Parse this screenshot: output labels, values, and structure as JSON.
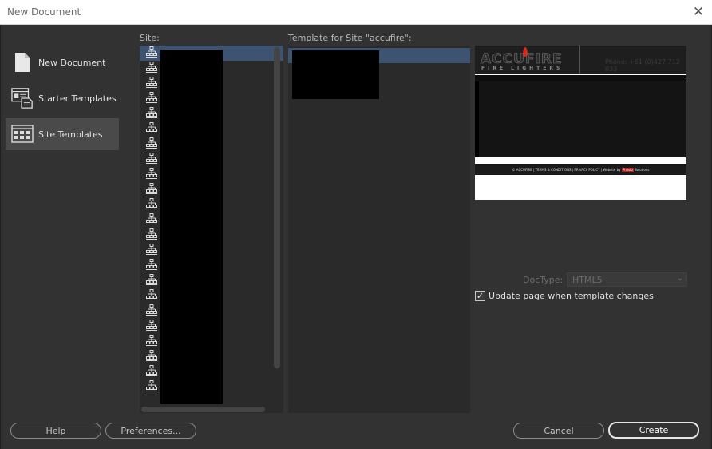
{
  "window": {
    "title": "New Document",
    "close_glyph": "✕"
  },
  "nav": {
    "items": [
      {
        "label": "New Document",
        "icon": "document-icon"
      },
      {
        "label": "Starter Templates",
        "icon": "starter-templates-icon"
      },
      {
        "label": "Site Templates",
        "icon": "site-templates-icon",
        "active": true
      }
    ]
  },
  "site_panel": {
    "label": "Site:",
    "row_icon": "site-tree-icon",
    "row_count": 23
  },
  "template_panel": {
    "label": "Template for Site \"accufire\":"
  },
  "preview": {
    "logo_text": "ACCUFIRE",
    "logo_subtext": "FIRE LIGHTERS",
    "phone_text": "Phone: +61 (0)427 712 033",
    "footer_text": "© ACCUFIRE | TERMS & CONDITIONS | PRIVACY POLICY | Website by",
    "footer_badge": "Physio",
    "footer_tail": "Solutions",
    "colors": {
      "header": "#1e1e1e",
      "flame": "#d62a1a",
      "body": "#141414"
    }
  },
  "options": {
    "doctype_label": "DocType:",
    "doctype_value": "HTML5",
    "update_label": "Update page when template changes",
    "update_checked": true
  },
  "buttons": {
    "help": "Help",
    "preferences": "Preferences...",
    "cancel": "Cancel",
    "create": "Create"
  },
  "colors": {
    "background": "#323232",
    "panel": "#2a2a2a",
    "selection": "#3d5372",
    "active_nav": "#4a4a4a"
  }
}
